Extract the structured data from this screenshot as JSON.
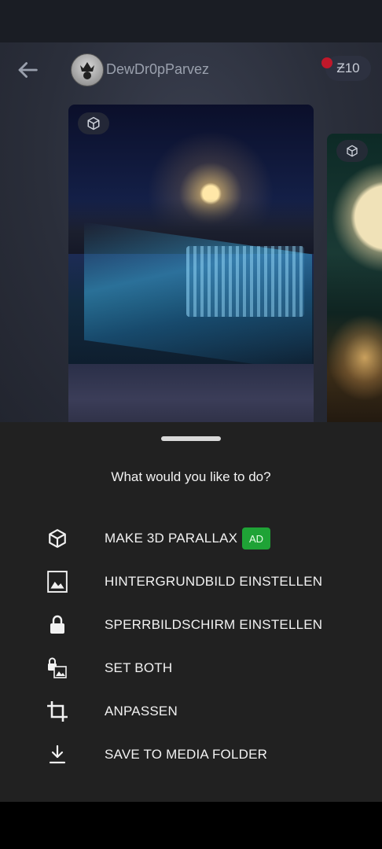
{
  "header": {
    "username": "DewDr0pParvez",
    "coins": "Ƶ10"
  },
  "sheet": {
    "title": "What would you like to do?",
    "items": [
      {
        "label": "MAKE 3D PARALLAX",
        "icon": "cube-icon",
        "badge": "AD"
      },
      {
        "label": "HINTERGRUNDBILD EINSTELLEN",
        "icon": "image-icon"
      },
      {
        "label": "SPERRBILDSCHIRM EINSTELLEN",
        "icon": "lock-icon"
      },
      {
        "label": "SET BOTH",
        "icon": "lock-image-icon"
      },
      {
        "label": "ANPASSEN",
        "icon": "crop-icon"
      },
      {
        "label": "SAVE TO MEDIA FOLDER",
        "icon": "download-icon"
      }
    ]
  },
  "colors": {
    "sheet_background": "#212121",
    "ad_badge": "#1fa336",
    "notification_dot": "#c0182a"
  }
}
